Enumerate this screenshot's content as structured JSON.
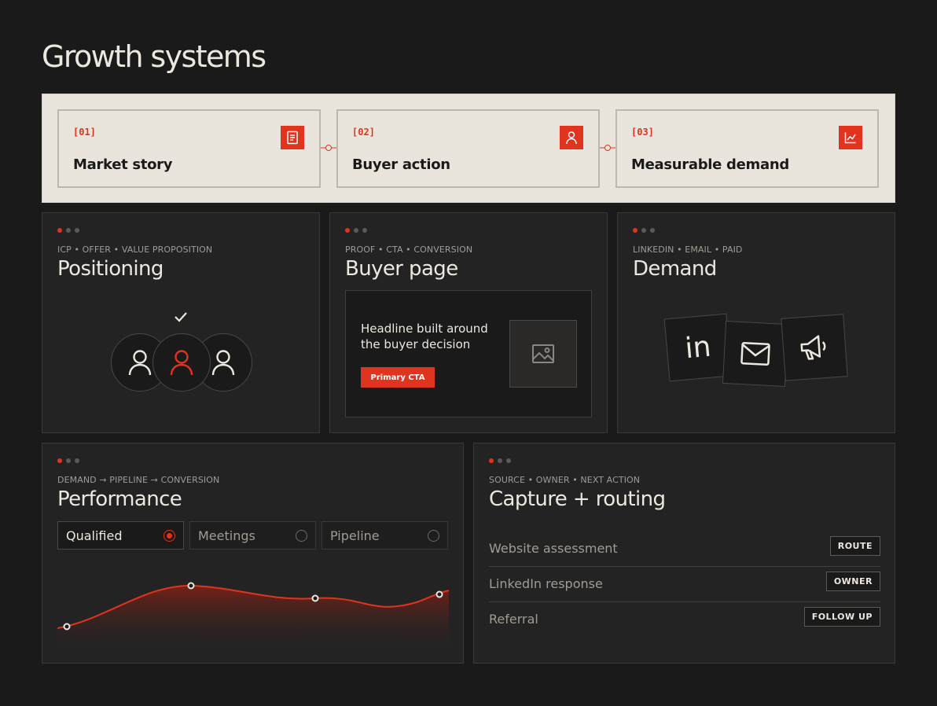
{
  "page": {
    "title": "Growth systems"
  },
  "flow": {
    "steps": [
      {
        "num": "[01]",
        "title": "Market story",
        "icon": "book-icon"
      },
      {
        "num": "[02]",
        "title": "Buyer action",
        "icon": "user-icon"
      },
      {
        "num": "[03]",
        "title": "Measurable demand",
        "icon": "chart-icon"
      }
    ]
  },
  "positioning": {
    "eyebrow": "ICP • OFFER • VALUE PROPOSITION",
    "title": "Positioning"
  },
  "buyer_page": {
    "eyebrow": "PROOF • CTA • CONVERSION",
    "title": "Buyer page",
    "headline": "Headline built around the buyer decision",
    "cta": "Primary CTA"
  },
  "demand": {
    "eyebrow": "LINKEDIN • EMAIL • PAID",
    "title": "Demand",
    "channels": [
      "linkedin-icon",
      "email-icon",
      "megaphone-icon"
    ]
  },
  "performance": {
    "eyebrow": "DEMAND → PIPELINE → CONVERSION",
    "title": "Performance",
    "tabs": [
      {
        "label": "Qualified",
        "selected": true
      },
      {
        "label": "Meetings",
        "selected": false
      },
      {
        "label": "Pipeline",
        "selected": false
      }
    ]
  },
  "routing": {
    "eyebrow": "SOURCE • OWNER • NEXT ACTION",
    "title": "Capture + routing",
    "rows": [
      {
        "label": "Website assessment",
        "tag": "ROUTE"
      },
      {
        "label": "LinkedIn response",
        "tag": "OWNER"
      },
      {
        "label": "Referral",
        "tag": "FOLLOW UP"
      }
    ]
  },
  "colors": {
    "accent": "#e0341f",
    "background": "#1b1a1a",
    "card": "#242323",
    "cream": "#e9e5dc"
  }
}
